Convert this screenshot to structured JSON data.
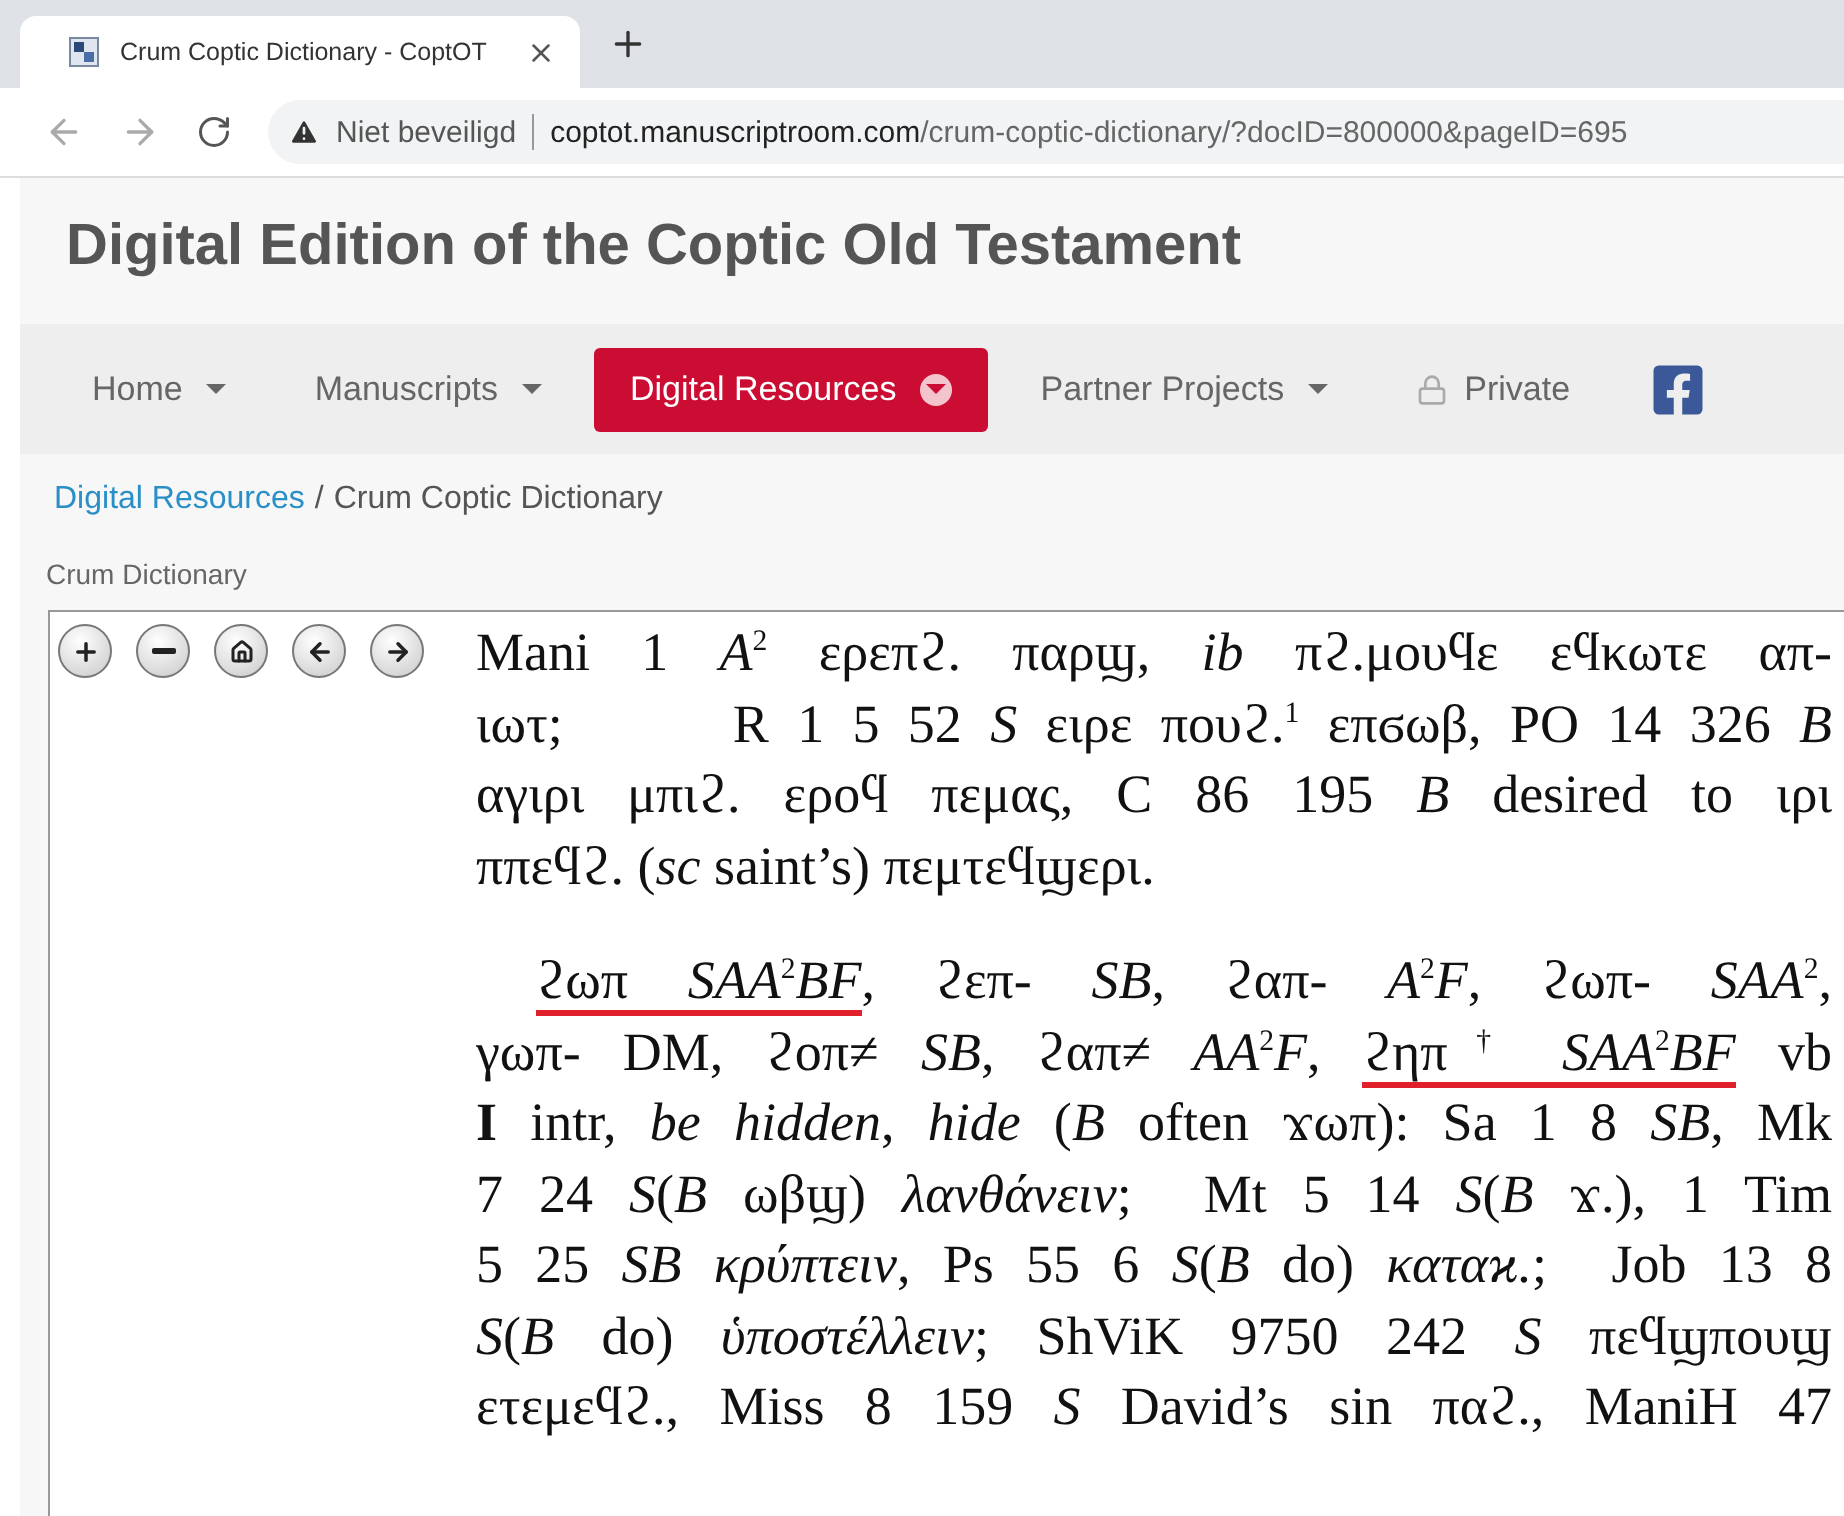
{
  "browser": {
    "tab_title": "Crum Coptic Dictionary - CoptOT",
    "security": "Niet beveiligd",
    "url_host": "coptot.manuscriptroom.com",
    "url_path": "/crum-coptic-dictionary/?docID=800000&pageID=695"
  },
  "site_title": "Digital Edition of the Coptic Old Testament",
  "nav": [
    {
      "label": "Home",
      "kind": "dropdown",
      "selected": false
    },
    {
      "label": "Manuscripts",
      "kind": "dropdown",
      "selected": false
    },
    {
      "label": "Digital Resources",
      "kind": "dropdown",
      "selected": true
    },
    {
      "label": "Partner Projects",
      "kind": "dropdown",
      "selected": false
    },
    {
      "label": "Private",
      "kind": "locked",
      "selected": false
    }
  ],
  "breadcrumb": {
    "link": "Digital Resources",
    "separator": "/",
    "current": "Crum Coptic Dictionary"
  },
  "viewer": {
    "label": "Crum Dictionary",
    "paragraphs": [
      [
        [
          {
            "text": "Mani 1 *A*$^{2}$ ερεπϩ. παρϣ, *ib* πϩ.μουϥε εϥκωτε απ-",
            "underlined": false
          }
        ],
        [
          {
            "text": "ιωτ;      R 1 5 52 *S* ειρε πουϩ.$^{1}$ επϭωβ, PO 14 326 *B*",
            "underlined": false
          }
        ],
        [
          {
            "text": "αγιρι μπιϩ. εροϥ πεμας, C 86 195 *B* desired to ιρι",
            "underlined": false
          }
        ],
        [
          {
            "text": "ππεϥϩ. (*sc* saint’s) πεμτεϥϣερι.",
            "underlined": false
          }
        ]
      ],
      [
        [
          {
            "text": "ϩωπ *SAA*$^{2}$*BF*",
            "underlined": true
          },
          {
            "text": ", ϩεπ- *SB*, ϩαπ- *A*$^{2}$*F*, ϩωπ- *SAA*$^{2}$,",
            "underlined": false
          }
        ],
        [
          {
            "text": "γωπ- DM, ϩοπ≠ *SB*, ϩαπ≠ *AA*$^{2}$*F*, ",
            "underlined": false
          },
          {
            "text": "ϩηπ$^{†}$ *SAA*$^{2}$*BF*",
            "underlined": true
          },
          {
            "text": " vb",
            "underlined": false
          }
        ],
        [
          {
            "text": "**I** intr, *be hidden*, *hide* (*B* often ϫωπ): Sa 1 8 *SB*, Mk",
            "underlined": false
          }
        ],
        [
          {
            "text": "7 24 *S*(*B* ωβϣ) *λανθάνειν*;  Mt 5 14 *S*(*B* ϫ.), 1 Tim",
            "underlined": false
          }
        ],
        [
          {
            "text": "5 25 *SB κρύπτειν*, Ps 55 6 *S*(*B* do) *καταϰ.*;  Job 13 8",
            "underlined": false
          }
        ],
        [
          {
            "text": "*S*(*B* do) *ὑποστέλλειν*; ShViK 9750 242 *S* πεϥϣπουϣ",
            "underlined": false
          }
        ],
        [
          {
            "text": "ετεμεϥϩ., Miss 8 159 *S* David’s sin παϩ., ManiH 47",
            "underlined": false
          }
        ]
      ]
    ]
  }
}
